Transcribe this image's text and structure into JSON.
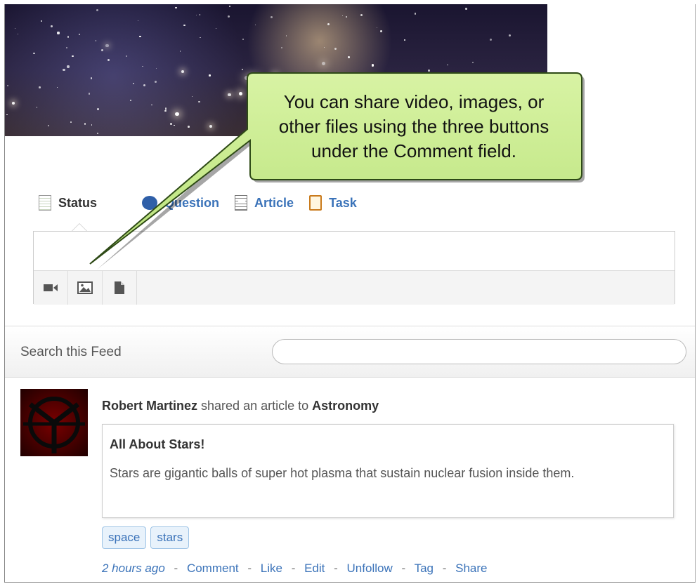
{
  "tabs": [
    {
      "label": "Status",
      "icon": "status-icon",
      "active": true
    },
    {
      "label": "Question",
      "icon": "question-icon",
      "active": false
    },
    {
      "label": "Article",
      "icon": "article-icon",
      "active": false
    },
    {
      "label": "Task",
      "icon": "task-icon",
      "active": false
    }
  ],
  "composer": {
    "placeholder": "",
    "tools": [
      "video-icon",
      "image-icon",
      "file-icon"
    ]
  },
  "callout": {
    "line1": "You can share video, images, or",
    "line2": "other files using the three buttons",
    "line3": "under the Comment field."
  },
  "search": {
    "label": "Search this Feed",
    "placeholder": ""
  },
  "post": {
    "author": "Robert Martinez",
    "action": "shared an article to",
    "group": "Astronomy",
    "article_title": "All About Stars!",
    "article_body": "Stars are gigantic balls of super hot plasma that sustain nuclear fusion inside them.",
    "tags": [
      "space",
      "stars"
    ],
    "time": "2 hours ago",
    "actions": [
      "Comment",
      "Like",
      "Edit",
      "Unfollow",
      "Tag",
      "Share"
    ],
    "separator": "-"
  },
  "colors": {
    "link": "#3b73b9",
    "callout_fill": "#c9ec8a",
    "callout_border": "#3a5a22"
  }
}
